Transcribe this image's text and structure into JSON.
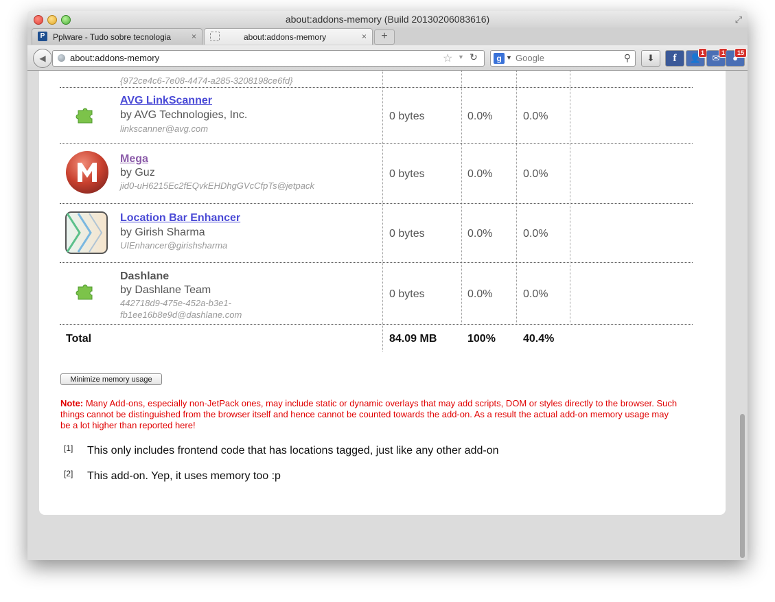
{
  "window": {
    "title": "about:addons-memory (Build 20130206083616)"
  },
  "tabs": [
    {
      "label": "Pplware - Tudo sobre tecnologia",
      "close": "×",
      "favicon": "P"
    },
    {
      "label": "about:addons-memory",
      "close": "×"
    }
  ],
  "new_tab": "+",
  "navbar": {
    "url": "about:addons-memory",
    "search_placeholder": "Google",
    "search_engine": "g"
  },
  "toolbar_badges": {
    "friends": "1",
    "messages": "1",
    "notifications": "15"
  },
  "addons": [
    {
      "name": "",
      "author": "",
      "id": "{972ce4c6-7e08-4474-a285-3208198ce6fd}",
      "memory": "",
      "pct_addons": "",
      "pct_total": "",
      "icon": "puzzle-icon",
      "style": "plain"
    },
    {
      "name": "AVG LinkScanner",
      "author": "by AVG Technologies, Inc.",
      "id": "linkscanner@avg.com",
      "memory": "0 bytes",
      "pct_addons": "0.0%",
      "pct_total": "0.0%",
      "icon": "puzzle-icon",
      "style": "link"
    },
    {
      "name": "Mega",
      "author": "by Guz",
      "id": "jid0-uH6215Ec2fEQvkEHDhgGVcCfpTs@jetpack",
      "memory": "0 bytes",
      "pct_addons": "0.0%",
      "pct_total": "0.0%",
      "icon": "mega-logo-icon",
      "style": "visited"
    },
    {
      "name": "Location Bar Enhancer",
      "author": "by Girish Sharma",
      "id": "UIEnhancer@girishsharma",
      "memory": "0 bytes",
      "pct_addons": "0.0%",
      "pct_total": "0.0%",
      "icon": "location-bar-enhancer-icon",
      "style": "link"
    },
    {
      "name": "Dashlane",
      "author": "by Dashlane Team",
      "id": "442718d9-475e-452a-b3e1-\nfb1ee16b8e9d@dashlane.com",
      "memory": "0 bytes",
      "pct_addons": "0.0%",
      "pct_total": "0.0%",
      "icon": "puzzle-icon",
      "style": "plain"
    }
  ],
  "total": {
    "label": "Total",
    "memory": "84.09 MB",
    "pct_addons": "100%",
    "pct_total": "40.4%"
  },
  "minimize_button": "Minimize memory usage",
  "note": {
    "prefix": "Note:",
    "text": " Many Add-ons, especially non-JetPack ones, may include static or dynamic overlays that may add scripts, DOM or styles directly to the browser. Such things cannot be distinguished from the browser itself and hence cannot be counted towards the add-on. As a result the actual add-on memory usage may be a lot higher than reported here!"
  },
  "footnotes": [
    {
      "mark": "[1]",
      "text": "This only includes frontend code that has locations tagged, just like any other add-on"
    },
    {
      "mark": "[2]",
      "text": "This add-on. Yep, it uses memory too :p"
    }
  ]
}
